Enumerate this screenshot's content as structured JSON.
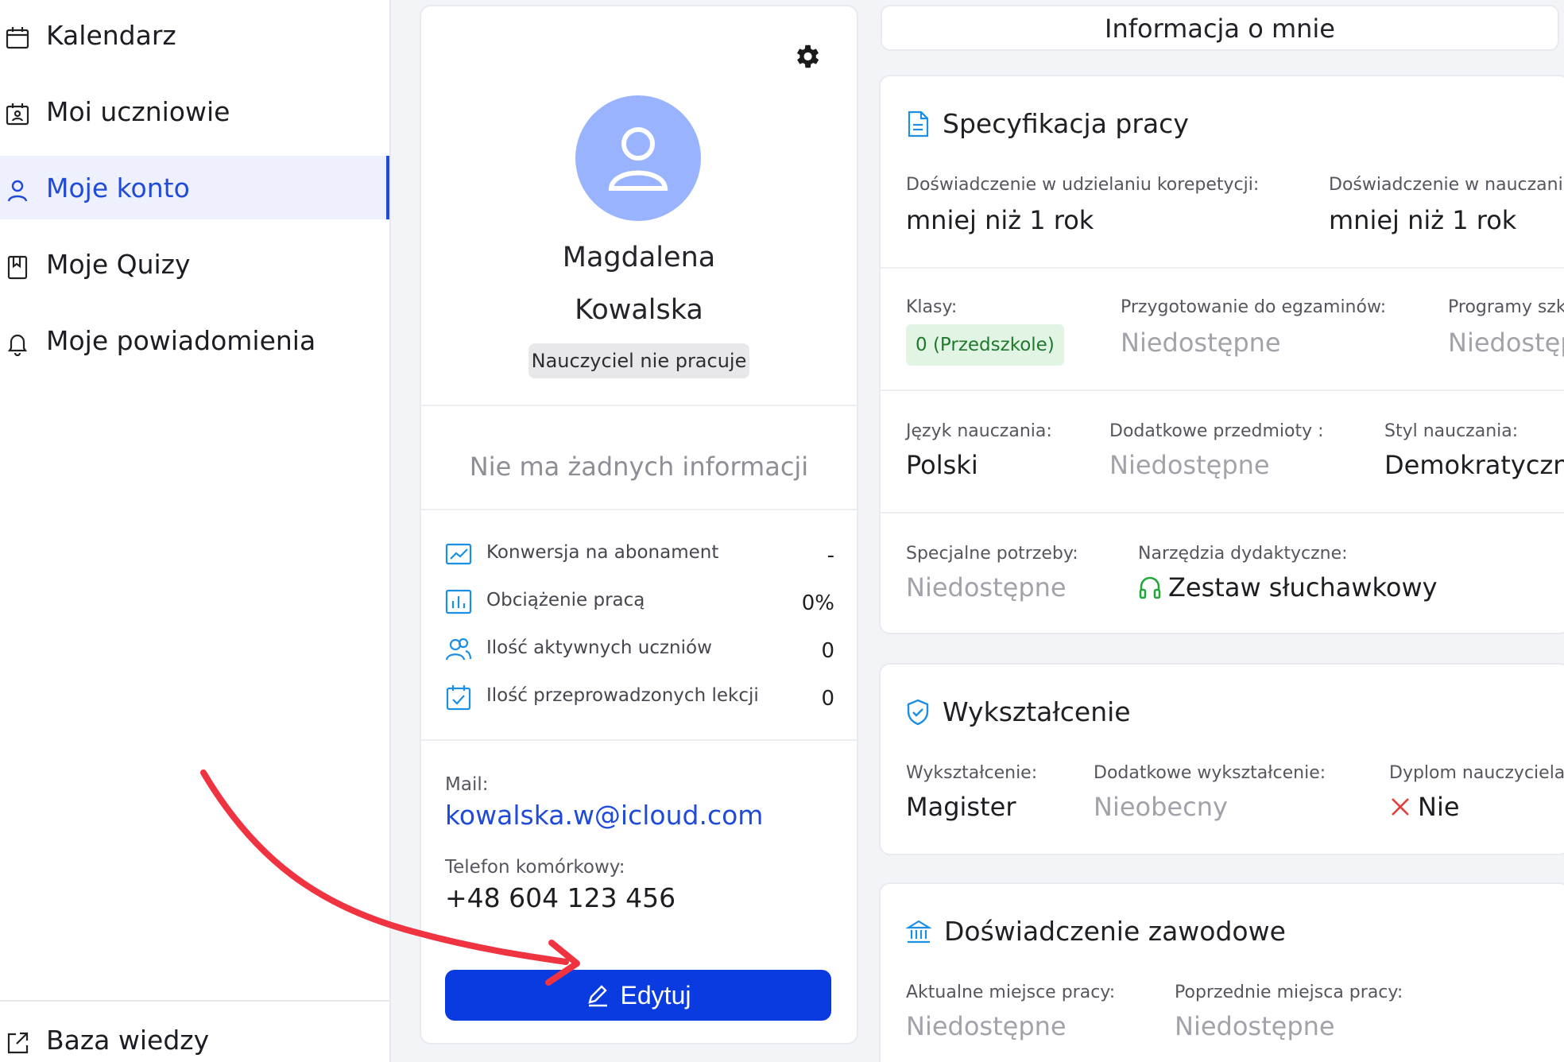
{
  "sidebar": {
    "items": [
      {
        "label": "Kalendarz",
        "icon": "calendar-icon"
      },
      {
        "label": "Moi uczniowie",
        "icon": "students-icon"
      },
      {
        "label": "Moje konto",
        "icon": "user-icon",
        "active": true
      },
      {
        "label": "Moje Quizy",
        "icon": "bookmark-icon"
      },
      {
        "label": "Moje powiadomienia",
        "icon": "bell-icon"
      }
    ],
    "footer_item": {
      "label": "Baza wiedzy",
      "icon": "external-link-icon"
    }
  },
  "profile": {
    "first_name": "Magdalena",
    "last_name": "Kowalska",
    "status": "Nauczyciel nie pracuje",
    "about": "Nie ma żadnych informacji",
    "stats": [
      {
        "label": "Konwersja na abonament",
        "value": "-",
        "icon": "chart-line-icon"
      },
      {
        "label": "Obciążenie pracą",
        "value": "0%",
        "icon": "bar-chart-icon"
      },
      {
        "label": "Ilość aktywnych uczniów",
        "value": "0",
        "icon": "users-icon"
      },
      {
        "label": "Ilość przeprowadzonych lekcji",
        "value": "0",
        "icon": "calendar-check-icon"
      }
    ],
    "mail_label": "Mail:",
    "mail": "kowalska.w@icloud.com",
    "phone_label": "Telefon komórkowy:",
    "phone": "+48 604 123 456",
    "edit_label": "Edytuj"
  },
  "info": {
    "header": "Informacja o mnie",
    "job_spec": {
      "title": "Specyfikacja pracy",
      "exp_tutoring_label": "Doświadczenie w udzielaniu korepetycji:",
      "exp_tutoring_value": "mniej niż 1 rok",
      "exp_teaching_label": "Doświadczenie w nauczaniu",
      "exp_teaching_value": "mniej niż 1 rok",
      "classes_label": "Klasy:",
      "classes_value": "0 (Przedszkole)",
      "exam_prep_label": "Przygotowanie do egzaminów:",
      "exam_prep_value": "Niedostępne",
      "programs_label": "Programy szkolne:",
      "programs_value": "Niedostępne",
      "language_label": "Język nauczania:",
      "language_value": "Polski",
      "extra_subjects_label": "Dodatkowe przedmioty :",
      "extra_subjects_value": "Niedostępne",
      "style_label": "Styl nauczania:",
      "style_value": "Demokratyczny",
      "special_needs_label": "Specjalne potrzeby:",
      "special_needs_value": "Niedostępne",
      "tools_label": "Narzędzia dydaktyczne:",
      "tools_value": "Zestaw słuchawkowy"
    },
    "education": {
      "title": "Wykształcenie",
      "edu_label": "Wykształcenie:",
      "edu_value": "Magister",
      "extra_edu_label": "Dodatkowe wykształcenie:",
      "extra_edu_value": "Nieobecny",
      "diploma_label": "Dyplom nauczyciela:",
      "diploma_value": "Nie"
    },
    "experience": {
      "title": "Doświadczenie zawodowe",
      "current_label": "Aktualne miejsce pracy:",
      "current_value": "Niedostępne",
      "previous_label": "Poprzednie miejsca pracy:",
      "previous_value": "Niedostępne"
    }
  },
  "colors": {
    "primary": "#0a3be0",
    "active_nav": "#1f4bd8",
    "avatar_bg": "#9ab3ff",
    "accent_icon": "#1a8fe3",
    "success": "#22a83a",
    "danger": "#e53b3b",
    "annotation_arrow": "#ef3340"
  }
}
